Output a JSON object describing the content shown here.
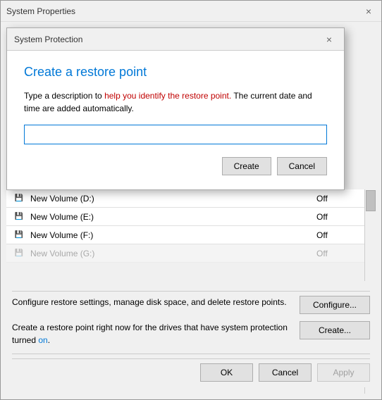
{
  "outerWindow": {
    "title": "System Properties",
    "closeLabel": "×"
  },
  "modal": {
    "title": "System Protection",
    "closeLabel": "×",
    "heading": "Create a restore point",
    "description_part1": "Type a description to ",
    "description_highlight": "help you identify the restore point.",
    "description_part2": " The current date and time are added automatically.",
    "inputPlaceholder": "",
    "createLabel": "Create",
    "cancelLabel": "Cancel"
  },
  "table": {
    "rows": [
      {
        "name": "New Volume (D:)",
        "status": "Off"
      },
      {
        "name": "New Volume (E:)",
        "status": "Off"
      },
      {
        "name": "New Volume (F:)",
        "status": "Off"
      },
      {
        "name": "New Volume (G:)",
        "status": "Off"
      }
    ]
  },
  "configureSection": {
    "description": "Configure restore settings, manage disk space, and delete restore points.",
    "buttonLabel": "Configure..."
  },
  "createSection": {
    "description_part1": "Create a restore point right now for the drives that have system protection turned ",
    "description_highlight": "on",
    "description_part2": ".",
    "buttonLabel": "Create..."
  },
  "bottomButtons": {
    "okLabel": "OK",
    "cancelLabel": "Cancel",
    "applyLabel": "Apply"
  }
}
